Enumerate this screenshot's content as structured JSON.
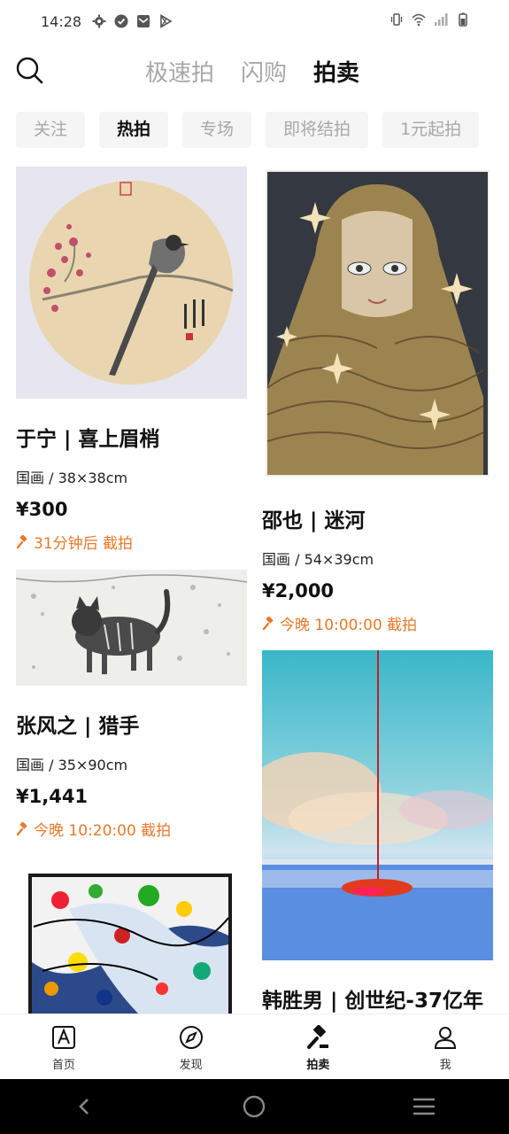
{
  "status": {
    "time": "14:28",
    "icons_left": [
      "settings-icon",
      "check-circle-icon",
      "mail-icon",
      "play-store-icon"
    ],
    "icons_right": [
      "vibrate-icon",
      "wifi-icon",
      "signal-icon",
      "battery-icon"
    ]
  },
  "header": {
    "tabs": [
      {
        "label": "极速拍",
        "active": false
      },
      {
        "label": "闪购",
        "active": false
      },
      {
        "label": "拍卖",
        "active": true
      }
    ]
  },
  "sub_tabs": [
    {
      "label": "关注",
      "active": false
    },
    {
      "label": "热拍",
      "active": true
    },
    {
      "label": "专场",
      "active": false
    },
    {
      "label": "即将结拍",
      "active": false
    },
    {
      "label": "1元起拍",
      "active": false
    }
  ],
  "items": [
    {
      "title": "于宁 | 喜上眉梢",
      "meta": "国画 / 38×38cm",
      "price": "¥300",
      "end": "31分钟后 截拍"
    },
    {
      "title": "邵也 | 迷河",
      "meta": "国画 / 54×39cm",
      "price": "¥2,000",
      "end": "今晚 10:00:00 截拍"
    },
    {
      "title": "张风之 | 猎手",
      "meta": "国画 / 35×90cm",
      "price": "¥1,441",
      "end": "今晚 10:20:00 截拍"
    },
    {
      "title": "韩胜男 | 创世纪-37亿年"
    },
    {}
  ],
  "bottom_nav": [
    {
      "label": "首页",
      "icon": "home-a-icon",
      "active": false
    },
    {
      "label": "发现",
      "icon": "compass-icon",
      "active": false
    },
    {
      "label": "拍卖",
      "icon": "gavel-icon",
      "active": true
    },
    {
      "label": "我",
      "icon": "user-icon",
      "active": false
    }
  ],
  "colors": {
    "accent": "#e8792a",
    "tab_inactive": "#a8a8a8",
    "chip_bg": "#f5f5f5"
  }
}
